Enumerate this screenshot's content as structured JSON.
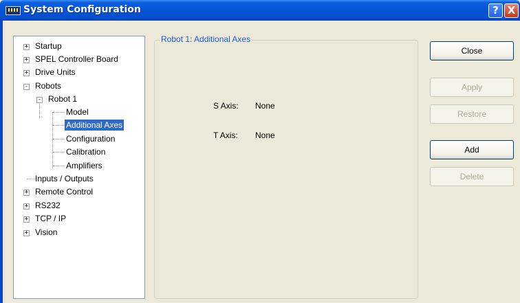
{
  "window": {
    "title": "System Configuration",
    "help_label": "?",
    "close_label": "X"
  },
  "tree": {
    "items": [
      {
        "label": "Startup",
        "expander": "+"
      },
      {
        "label": "SPEL Controller Board",
        "expander": "+"
      },
      {
        "label": "Drive Units",
        "expander": "+"
      },
      {
        "label": "Robots",
        "expander": "-"
      },
      {
        "label": "Robot 1",
        "expander": "-"
      },
      {
        "label": "Model"
      },
      {
        "label": "Additional Axes",
        "selected": true
      },
      {
        "label": "Configuration"
      },
      {
        "label": "Calibration"
      },
      {
        "label": "Amplifiers"
      },
      {
        "label": "Inputs / Outputs"
      },
      {
        "label": "Remote Control",
        "expander": "+"
      },
      {
        "label": "RS232",
        "expander": "+"
      },
      {
        "label": "TCP / IP",
        "expander": "+"
      },
      {
        "label": "Vision",
        "expander": "+"
      }
    ]
  },
  "group": {
    "title": "Robot 1: Additional Axes",
    "s_axis_label": "S Axis:",
    "s_axis_value": "None",
    "t_axis_label": "T Axis:",
    "t_axis_value": "None"
  },
  "buttons": {
    "close": "Close",
    "apply": "Apply",
    "restore": "Restore",
    "add": "Add",
    "delete": "Delete"
  },
  "colors": {
    "titlebar": "#0454d6",
    "selection": "#316ac5",
    "group_title": "#1c5ac8",
    "dialog_bg": "#ece9d8"
  }
}
